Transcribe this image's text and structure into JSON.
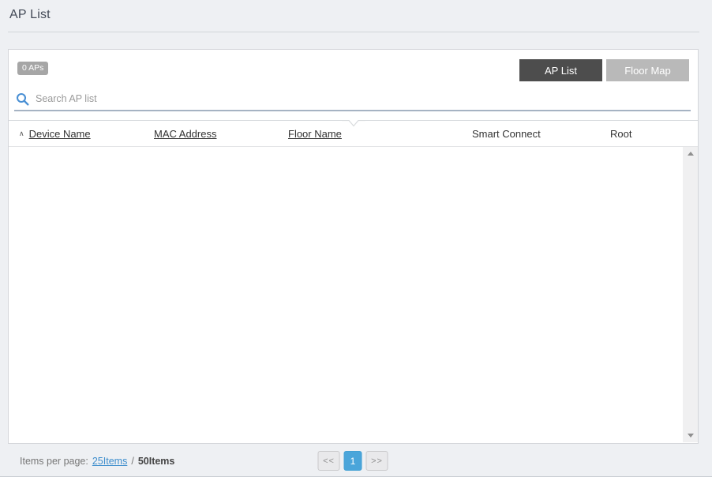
{
  "page": {
    "title": "AP List"
  },
  "toolbar": {
    "ap_count_badge": "0 APs",
    "view_buttons": [
      {
        "label": "AP List",
        "active": true
      },
      {
        "label": "Floor Map",
        "active": false
      }
    ]
  },
  "search": {
    "placeholder": "Search AP list"
  },
  "icons": {
    "sort_asc": "∧",
    "search": "magnifier",
    "collapse_notch": "chevron-down",
    "scroll_up": "triangle-up",
    "scroll_down": "triangle-down"
  },
  "table": {
    "columns": [
      {
        "label": "Device Name",
        "sortable": true,
        "sorted": "asc"
      },
      {
        "label": "MAC Address",
        "sortable": true,
        "sorted": null
      },
      {
        "label": "Floor Name",
        "sortable": true,
        "sorted": null
      },
      {
        "label": "Smart Connect",
        "sortable": false,
        "sorted": null
      },
      {
        "label": "Root",
        "sortable": false,
        "sorted": null
      }
    ],
    "rows": []
  },
  "pagination": {
    "items_per_page_label": "Items per page:",
    "options": [
      {
        "label": "25Items",
        "selected": false
      },
      {
        "label": "50Items",
        "selected": true
      }
    ],
    "separator": "/",
    "prev_label": "<<",
    "page_number": "1",
    "next_label": ">>"
  },
  "colors": {
    "page_background": "#eef0f3",
    "card_background": "#ffffff",
    "badge_gray": "#a6a6a6",
    "button_active_dark": "#4d4d4d",
    "button_inactive_gray": "#b9b9b9",
    "search_icon_blue": "#4a90d4",
    "search_underline": "#a6b3c3",
    "link_blue": "#3e8ecd",
    "page_button_blue": "#4aa5da"
  }
}
